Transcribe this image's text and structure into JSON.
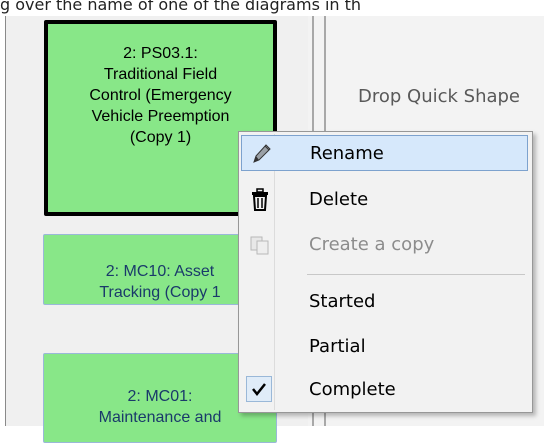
{
  "caption": "g over the name of one of the diagrams in th",
  "right_pane": {
    "drop_hint": "Drop Quick Shape"
  },
  "cards": [
    {
      "text": "2: PS03.1:\nTraditional Field\nControl (Emergency\nVehicle Preemption\n(Copy 1)",
      "selected": true
    },
    {
      "text": "2: MC10: Asset\nTracking (Copy 1",
      "selected": false
    },
    {
      "text": "2: MC01:\nMaintenance and",
      "selected": false
    }
  ],
  "context_menu": {
    "items": [
      {
        "label": "Rename",
        "icon": "pencil-icon",
        "state": "hover"
      },
      {
        "label": "Delete",
        "icon": "trash-icon",
        "state": "normal"
      },
      {
        "label": "Create a copy",
        "icon": "copy-icon",
        "state": "disabled"
      },
      {
        "label": "Started",
        "icon": "",
        "state": "normal"
      },
      {
        "label": "Partial",
        "icon": "",
        "state": "normal"
      },
      {
        "label": "Complete",
        "icon": "checkmark-icon",
        "state": "checked"
      }
    ]
  },
  "colors": {
    "card_fill": "#88e788",
    "card_text": "#1a3a6a",
    "menu_bg": "#f2f2f2",
    "menu_hover": "#d6e8fb"
  }
}
